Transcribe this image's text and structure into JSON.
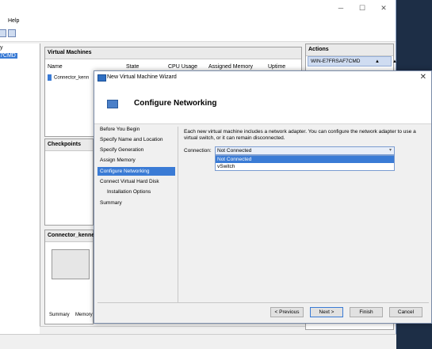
{
  "main_window": {
    "menu_help": "Help",
    "left_tree": [
      "y",
      "7CMD"
    ]
  },
  "vm_panel": {
    "title": "Virtual Machines",
    "columns": [
      "Name",
      "State",
      "CPU Usage",
      "Assigned Memory",
      "Uptime"
    ],
    "row_name": "Connector_kenn"
  },
  "checkpoints_title": "Checkpoints",
  "connector_panel": {
    "title": "Connector_kenne",
    "tabs": [
      "Summary",
      "Memory"
    ]
  },
  "actions_panel": {
    "title": "Actions",
    "item": "WIN-E7FRSAF7CMD"
  },
  "wizard": {
    "title": "New Virtual Machine Wizard",
    "heading": "Configure Networking",
    "steps": [
      {
        "label": "Before You Begin"
      },
      {
        "label": "Specify Name and Location"
      },
      {
        "label": "Specify Generation"
      },
      {
        "label": "Assign Memory"
      },
      {
        "label": "Configure Networking"
      },
      {
        "label": "Connect Virtual Hard Disk"
      },
      {
        "label": "Installation Options"
      },
      {
        "label": "Summary"
      }
    ],
    "active_step": "Configure Networking",
    "description": "Each new virtual machine includes a network adapter. You can configure the network adapter to use a virtual switch, or it can remain disconnected.",
    "connection_label": "Connection:",
    "connection_value": "Not Connected",
    "options": [
      "Not Connected",
      "vSwitch"
    ],
    "buttons": {
      "previous": "< Previous",
      "next": "Next >",
      "finish": "Finish",
      "cancel": "Cancel"
    }
  },
  "colors": {
    "accent": "#3a7bd5",
    "desktop": "#1d2e46",
    "window_bg": "#f0f0f0"
  }
}
